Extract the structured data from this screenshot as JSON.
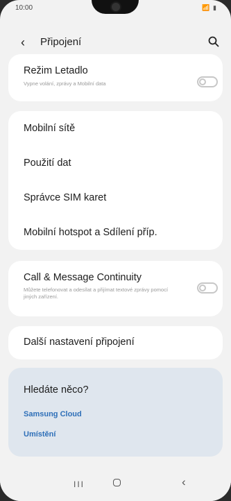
{
  "status": {
    "time": "10:00",
    "icons": "📶 ▮"
  },
  "header": {
    "back_icon": "chevron-left",
    "title": "Připojení",
    "search_icon": "search"
  },
  "airplane": {
    "title": "Režim Letadlo",
    "subtitle": "Vypne volání, zprávy a Mobilní data",
    "enabled": false
  },
  "menu": {
    "items": [
      {
        "label": "Mobilní sítě"
      },
      {
        "label": "Použití dat"
      },
      {
        "label": "Správce SIM karet"
      },
      {
        "label": "Mobilní hotspot a Sdílení příp."
      }
    ]
  },
  "continuity": {
    "title": "Call & Message Continuity",
    "subtitle": "Můžete telefonovat a odesílat a přijímat textové zprávy pomocí jiných zařízení.",
    "enabled": false
  },
  "more": {
    "label": "Další nastavení připojení"
  },
  "suggestions": {
    "title": "Hledáte něco?",
    "links": [
      "Samsung Cloud",
      "Umístění"
    ],
    "link_color": "#2e6fb8"
  },
  "navbar": {
    "recent": "III",
    "home_icon": "home",
    "back_icon": "back"
  }
}
